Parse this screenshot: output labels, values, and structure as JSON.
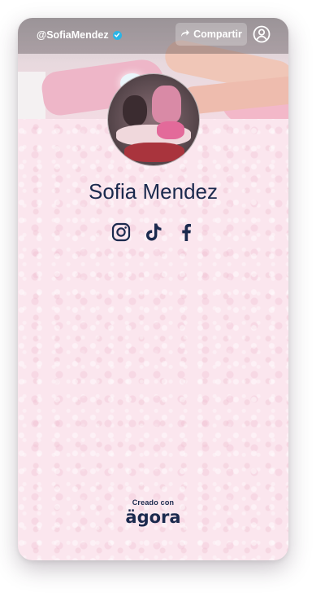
{
  "profile": {
    "handle": "@SofiaMendez",
    "verified": true,
    "name": "Sofia Mendez"
  },
  "header": {
    "share_label": "Compartir",
    "share_icon": "share-arrow-icon",
    "account_icon": "user-circle-icon"
  },
  "socials": [
    {
      "network": "instagram",
      "icon": "instagram-icon"
    },
    {
      "network": "tiktok",
      "icon": "tiktok-icon"
    },
    {
      "network": "facebook",
      "icon": "facebook-icon"
    }
  ],
  "footer": {
    "created_with": "Creado con",
    "brand": "ägora"
  },
  "colors": {
    "text_primary": "#1b2a4e",
    "background": "#fbe6ee",
    "verified_badge": "#2bb5e6"
  }
}
